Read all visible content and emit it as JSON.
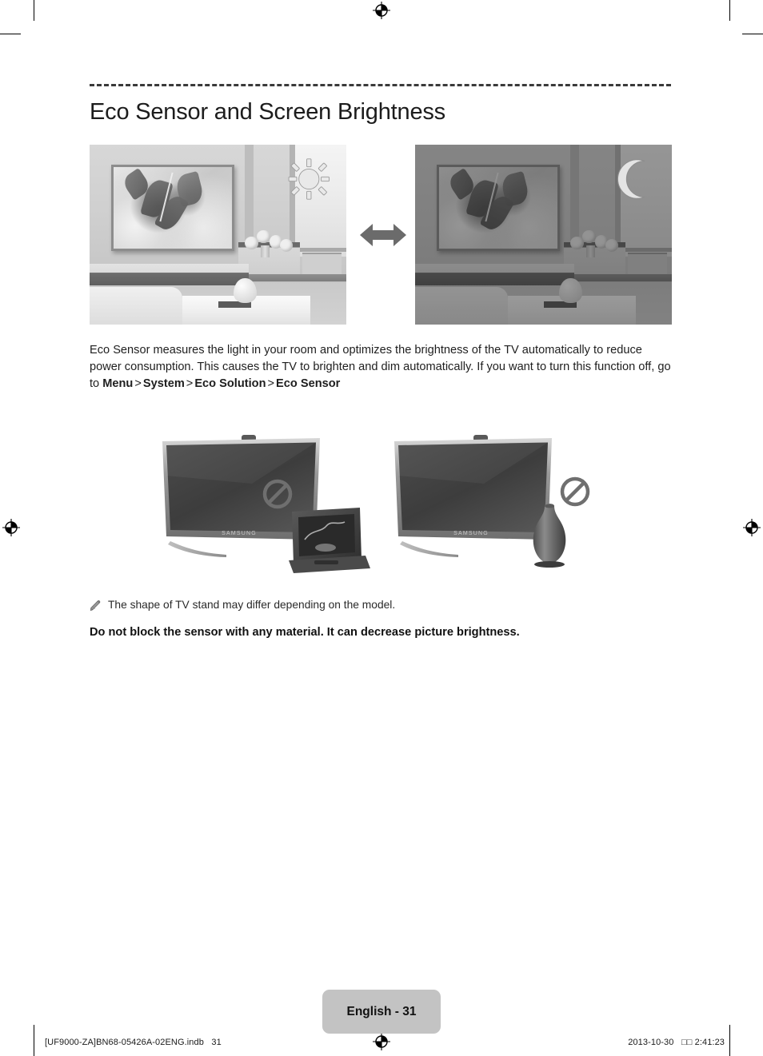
{
  "document": {
    "title": "Eco Sensor and Screen Brightness",
    "body_paragraph": {
      "part1": "Eco Sensor measures the light in your room and optimizes the brightness of the TV automatically to reduce power consumption. This causes the TV to brighten and dim automatically. If you want to turn this function off, go to ",
      "menu": "Menu",
      "sep1": ">",
      "system": "System",
      "sep2": ">",
      "eco_solution": "Eco Solution",
      "sep3": ">",
      "eco_sensor": "Eco Sensor"
    },
    "note": "The shape of TV stand may differ depending on the model.",
    "note_icon": "pencil-icon",
    "warning": "Do not block the sensor with any material. It can decrease picture brightness."
  },
  "figures": {
    "photo_bright": {
      "name": "bright-room-photo",
      "badge_icon": "sun-icon",
      "caption": ""
    },
    "photo_dark": {
      "name": "dark-room-photo",
      "badge_icon": "moon-icon",
      "caption": ""
    },
    "arrow_icon": "double-headed-arrow-icon",
    "tv_illustration_left": {
      "name": "tv-blocked-by-photo-frame",
      "prohibition_icon": "no-entry-icon",
      "brand": "SAMSUNG"
    },
    "tv_illustration_right": {
      "name": "tv-blocked-by-vase",
      "prohibition_icon": "no-entry-icon",
      "brand": "SAMSUNG"
    }
  },
  "footer": {
    "page_label": "English - 31",
    "file_ref": "[UF9000-ZA]BN68-05426A-02ENG.indb   31",
    "timestamp": "2013-10-30   □□ 2:41:23"
  },
  "colors": {
    "page_badge_bg": "#c3c3c3",
    "rule": "#3a3a3a",
    "arrow": "#6b6b6b",
    "text": "#1a1a1a"
  }
}
